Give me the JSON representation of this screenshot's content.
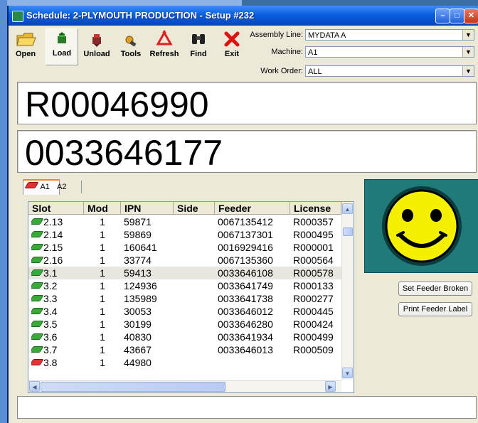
{
  "window": {
    "title": "Schedule: 2-PLYMOUTH PRODUCTION - Setup #232"
  },
  "toolbar": {
    "open": "Open",
    "load": "Load",
    "unload": "Unload",
    "tools": "Tools",
    "refresh": "Refresh",
    "find": "Find",
    "exit": "Exit"
  },
  "fields": {
    "assembly_line_label": "Assembly Line:",
    "assembly_line_value": "MYDATA A",
    "machine_label": "Machine:",
    "machine_value": "A1",
    "work_order_label": "Work Order:",
    "work_order_value": "ALL"
  },
  "display": {
    "line1": "R00046990",
    "line2": "0033646177"
  },
  "tabs": [
    "A1",
    "A2"
  ],
  "table": {
    "columns": [
      "Slot",
      "Mod",
      "IPN",
      "Side",
      "Feeder",
      "License"
    ],
    "rows": [
      {
        "slot": "2.13",
        "mod": "1",
        "ipn": "59871",
        "side": "",
        "feeder": "0067135412",
        "license": "R000357",
        "icon": "green"
      },
      {
        "slot": "2.14",
        "mod": "1",
        "ipn": "59869",
        "side": "",
        "feeder": "0067137301",
        "license": "R000495",
        "icon": "green"
      },
      {
        "slot": "2.15",
        "mod": "1",
        "ipn": "160641",
        "side": "",
        "feeder": "0016929416",
        "license": "R000001",
        "icon": "green"
      },
      {
        "slot": "2.16",
        "mod": "1",
        "ipn": "33774",
        "side": "",
        "feeder": "0067135360",
        "license": "R000564",
        "icon": "green"
      },
      {
        "slot": "3.1",
        "mod": "1",
        "ipn": "59413",
        "side": "",
        "feeder": "0033646108",
        "license": "R000578",
        "icon": "green"
      },
      {
        "slot": "3.2",
        "mod": "1",
        "ipn": "124936",
        "side": "",
        "feeder": "0033641749",
        "license": "R000133",
        "icon": "green"
      },
      {
        "slot": "3.3",
        "mod": "1",
        "ipn": "135989",
        "side": "",
        "feeder": "0033641738",
        "license": "R000277",
        "icon": "green"
      },
      {
        "slot": "3.4",
        "mod": "1",
        "ipn": "30053",
        "side": "",
        "feeder": "0033646012",
        "license": "R000445",
        "icon": "green"
      },
      {
        "slot": "3.5",
        "mod": "1",
        "ipn": "30199",
        "side": "",
        "feeder": "0033646280",
        "license": "R000424",
        "icon": "green"
      },
      {
        "slot": "3.6",
        "mod": "1",
        "ipn": "40830",
        "side": "",
        "feeder": "0033641934",
        "license": "R000499",
        "icon": "green"
      },
      {
        "slot": "3.7",
        "mod": "1",
        "ipn": "43667",
        "side": "",
        "feeder": "0033646013",
        "license": "R000509",
        "icon": "green"
      },
      {
        "slot": "3.8",
        "mod": "1",
        "ipn": "44980",
        "side": "",
        "feeder": "",
        "license": "",
        "icon": "red"
      }
    ],
    "selected_row": 4
  },
  "buttons": {
    "set_feeder_broken": "Set Feeder Broken",
    "print_feeder_label": "Print Feeder Label"
  },
  "colors": {
    "smiley_panel": "#217a7a",
    "smiley_face": "#f5f000",
    "title_bar": "#0a5fe0"
  }
}
